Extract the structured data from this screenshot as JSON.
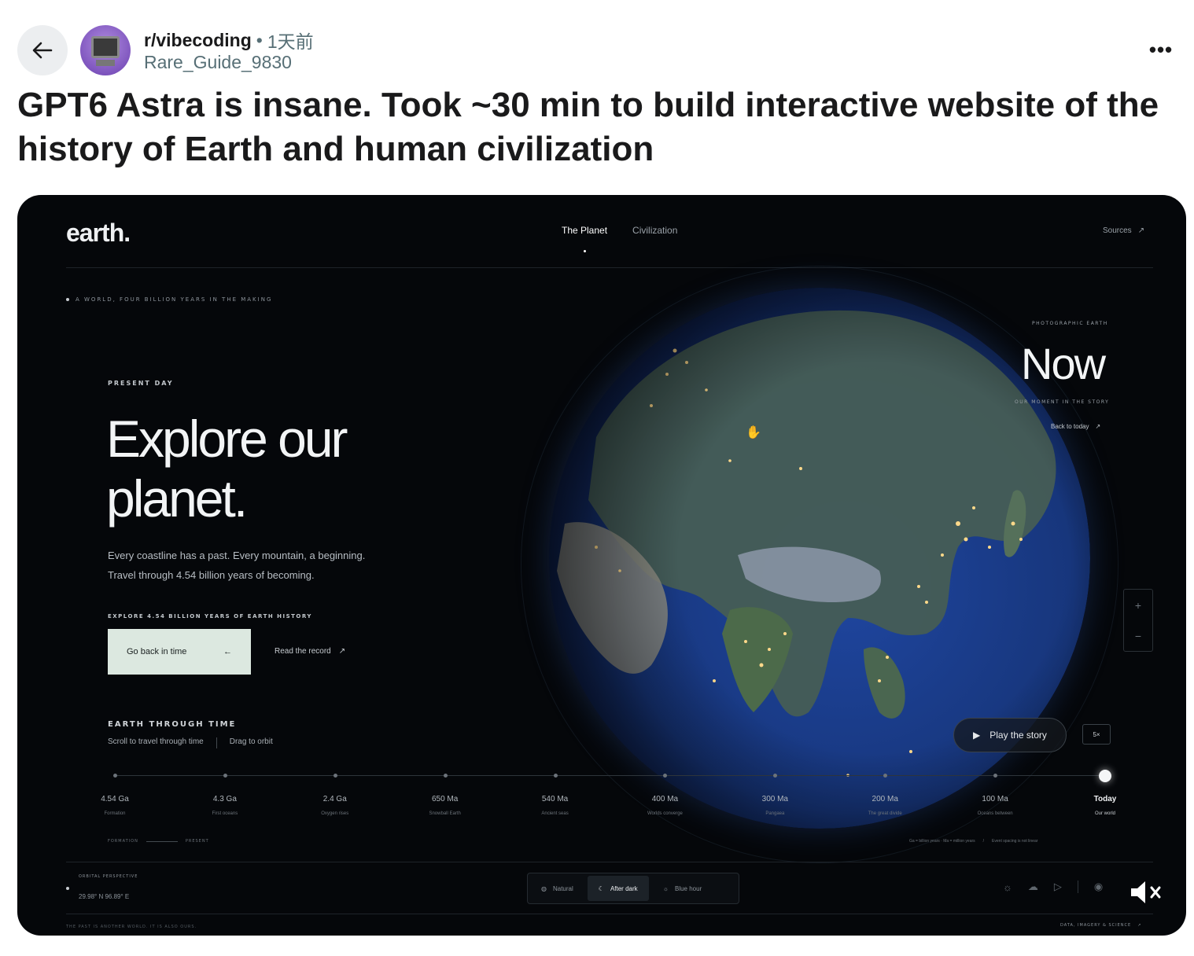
{
  "post": {
    "subreddit": "r/vibecoding",
    "separator": "•",
    "time": "1天前",
    "author": "Rare_Guide_9830",
    "more": "•••",
    "title": "GPT6 Astra is insane. Took ~30 min to build interactive website of the history of Earth and human civilization"
  },
  "site": {
    "logo": "earth.",
    "nav": [
      "The Planet",
      "Civilization"
    ],
    "sources": "Sources",
    "tagline": "A WORLD, FOUR BILLION YEARS IN THE MAKING",
    "eyebrow": "PRESENT DAY",
    "hero_line1": "Explore our",
    "hero_line2": "planet.",
    "hero_sub_1": "Every coastline has a past. Every mountain, a beginning.",
    "hero_sub_2": "Travel through 4.54 billion years of becoming.",
    "explore_label": "EXPLORE 4.54 BILLION YEARS OF EARTH HISTORY",
    "cta": "Go back in time",
    "read_link": "Read the record",
    "ett_title": "EARTH THROUGH TIME",
    "ett_scroll": "Scroll to travel through time",
    "ett_drag": "Drag to orbit",
    "now_label": "PHOTOGRAPHIC EARTH",
    "now_big": "Now",
    "now_sub": "OUR MOMENT IN THE STORY",
    "now_back": "Back to today",
    "zoom_in": "+",
    "zoom_out": "−",
    "play": "Play the story",
    "speed": "5×",
    "timeline": [
      {
        "value": "4.54 Ga",
        "label": "Formation"
      },
      {
        "value": "4.3 Ga",
        "label": "First oceans"
      },
      {
        "value": "2.4 Ga",
        "label": "Oxygen rises"
      },
      {
        "value": "650 Ma",
        "label": "Snowball Earth"
      },
      {
        "value": "540 Ma",
        "label": "Ancient seas"
      },
      {
        "value": "400 Ma",
        "label": "Worlds converge"
      },
      {
        "value": "300 Ma",
        "label": "Pangaea"
      },
      {
        "value": "200 Ma",
        "label": "The great divide"
      },
      {
        "value": "100 Ma",
        "label": "Oceans between"
      },
      {
        "value": "Today",
        "label": "Our world"
      }
    ],
    "legend_formation": "FORMATION",
    "legend_present": "PRESENT",
    "legend_units": "Ga = billion years · Ma = million years",
    "legend_slash": "/",
    "legend_spacing": "Event spacing is not linear",
    "orbital_label": "ORBITAL PERSPECTIVE",
    "orbital_coord": "29.98° N 96.89° E",
    "modes": [
      "Natural",
      "After dark",
      "Blue hour"
    ],
    "footer_left": "THE PAST IS ANOTHER WORLD. IT IS ALSO OURS.",
    "footer_right": "DATA, IMAGERY & SCIENCE"
  },
  "colors": {
    "media_bg": "#05070a",
    "cta_bg": "#dce8e0",
    "ocean": "#1d3f8a",
    "city_lights": "#ffd98a"
  }
}
